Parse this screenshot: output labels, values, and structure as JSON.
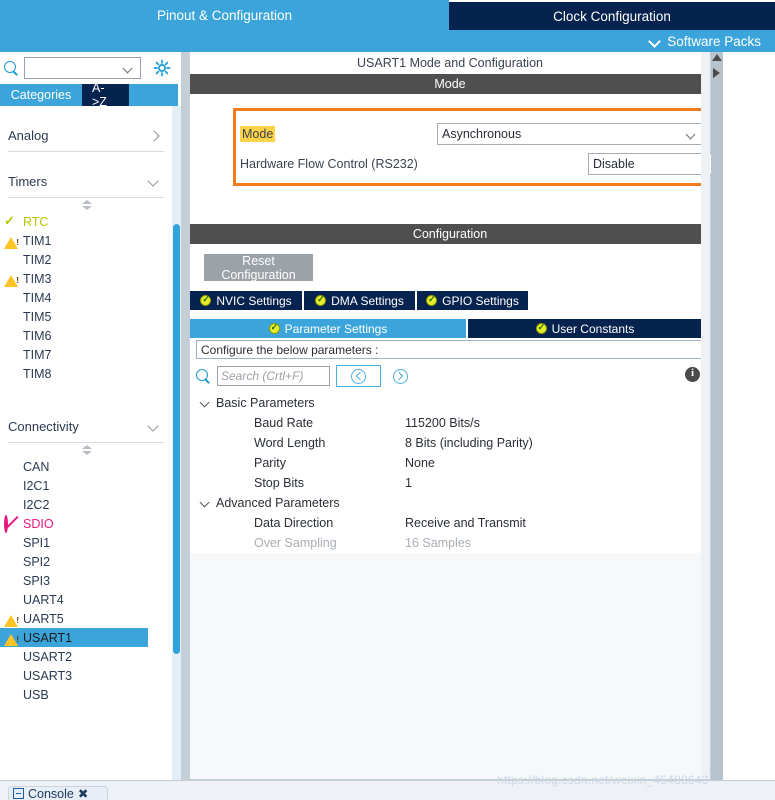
{
  "header": {
    "tabs": [
      {
        "label": "Pinout & Configuration",
        "active": true
      },
      {
        "label": "Clock Configuration",
        "active": false
      }
    ],
    "software_packs_label": "Software Packs",
    "chevron_icon": "chevron-down-icon"
  },
  "sidebar": {
    "search_placeholder": "",
    "search_value": "",
    "search_icon": "search-icon",
    "settings_icon": "gear-icon",
    "tabs": [
      {
        "label": "Categories",
        "active": true
      },
      {
        "label": "A->Z",
        "active": false
      }
    ],
    "groups": [
      {
        "label": "Analog",
        "expanded": false,
        "chevron": "chevron-right-icon"
      },
      {
        "label": "Timers",
        "expanded": true,
        "chevron": "chevron-down-icon"
      },
      {
        "label": "Connectivity",
        "expanded": true,
        "chevron": "chevron-down-icon"
      }
    ],
    "timers": [
      {
        "label": "RTC",
        "status": "check",
        "selected": false
      },
      {
        "label": "TIM1",
        "status": "warning",
        "selected": false
      },
      {
        "label": "TIM2",
        "status": "none",
        "selected": false
      },
      {
        "label": "TIM3",
        "status": "warning",
        "selected": false
      },
      {
        "label": "TIM4",
        "status": "none",
        "selected": false
      },
      {
        "label": "TIM5",
        "status": "none",
        "selected": false
      },
      {
        "label": "TIM6",
        "status": "none",
        "selected": false
      },
      {
        "label": "TIM7",
        "status": "none",
        "selected": false
      },
      {
        "label": "TIM8",
        "status": "none",
        "selected": false
      }
    ],
    "connectivity": [
      {
        "label": "CAN",
        "status": "none",
        "selected": false
      },
      {
        "label": "I2C1",
        "status": "none",
        "selected": false
      },
      {
        "label": "I2C2",
        "status": "none",
        "selected": false
      },
      {
        "label": "SDIO",
        "status": "blocked",
        "selected": false
      },
      {
        "label": "SPI1",
        "status": "none",
        "selected": false
      },
      {
        "label": "SPI2",
        "status": "none",
        "selected": false
      },
      {
        "label": "SPI3",
        "status": "none",
        "selected": false
      },
      {
        "label": "UART4",
        "status": "none",
        "selected": false
      },
      {
        "label": "UART5",
        "status": "warning",
        "selected": false
      },
      {
        "label": "USART1",
        "status": "warning",
        "selected": true
      },
      {
        "label": "USART2",
        "status": "none",
        "selected": false
      },
      {
        "label": "USART3",
        "status": "none",
        "selected": false
      },
      {
        "label": "USB",
        "status": "none",
        "selected": false
      }
    ]
  },
  "main": {
    "panel_title": "USART1 Mode and Configuration",
    "mode_section": {
      "header": "Mode",
      "rows": [
        {
          "label": "Mode",
          "value": "Asynchronous",
          "highlighted": true
        },
        {
          "label": "Hardware Flow Control (RS232)",
          "value": "Disable",
          "highlighted": false
        }
      ],
      "highlight_color": "#f07c1e"
    },
    "configuration_section": {
      "header": "Configuration",
      "reset_button": "Reset Configuration",
      "tabs_row1": [
        {
          "label": "NVIC Settings",
          "active": false,
          "icon": "check-circle-icon"
        },
        {
          "label": "DMA Settings",
          "active": false,
          "icon": "check-circle-icon"
        },
        {
          "label": "GPIO Settings",
          "active": false,
          "icon": "check-circle-icon"
        }
      ],
      "tabs_row2": [
        {
          "label": "Parameter Settings",
          "active": true,
          "icon": "check-circle-icon"
        },
        {
          "label": "User Constants",
          "active": false,
          "icon": "check-circle-icon"
        }
      ],
      "hint": "Configure the below parameters :",
      "search_placeholder": "Search (Crtl+F)",
      "search_value": "",
      "prev_icon": "chevron-left-circle-icon",
      "next_icon": "chevron-right-circle-icon",
      "info_icon": "info-icon",
      "parameter_groups": [
        {
          "name": "Basic Parameters",
          "expanded": true,
          "rows": [
            {
              "name": "Baud Rate",
              "value": "115200 Bits/s",
              "disabled": false
            },
            {
              "name": "Word Length",
              "value": "8 Bits (including Parity)",
              "disabled": false
            },
            {
              "name": "Parity",
              "value": "None",
              "disabled": false
            },
            {
              "name": "Stop Bits",
              "value": "1",
              "disabled": false
            }
          ]
        },
        {
          "name": "Advanced Parameters",
          "expanded": true,
          "rows": [
            {
              "name": "Data Direction",
              "value": "Receive and Transmit",
              "disabled": false
            },
            {
              "name": "Over Sampling",
              "value": "16 Samples",
              "disabled": true
            }
          ]
        }
      ]
    }
  },
  "bottom": {
    "console_label": "Console",
    "console_icon": "console-icon",
    "console_close": "✖"
  },
  "watermark": "https://blog.csdn.net/weixin_45488643",
  "colors": {
    "brand_blue": "#3ba5db",
    "dark_navy": "#06234f",
    "section_header": "#4f4f4f",
    "highlight_orange": "#f07c1e",
    "highlight_yellow": "#ffd24a",
    "ok_green": "#b5c400",
    "warn_yellow": "#ffc423",
    "error_pink": "#e5197f"
  }
}
